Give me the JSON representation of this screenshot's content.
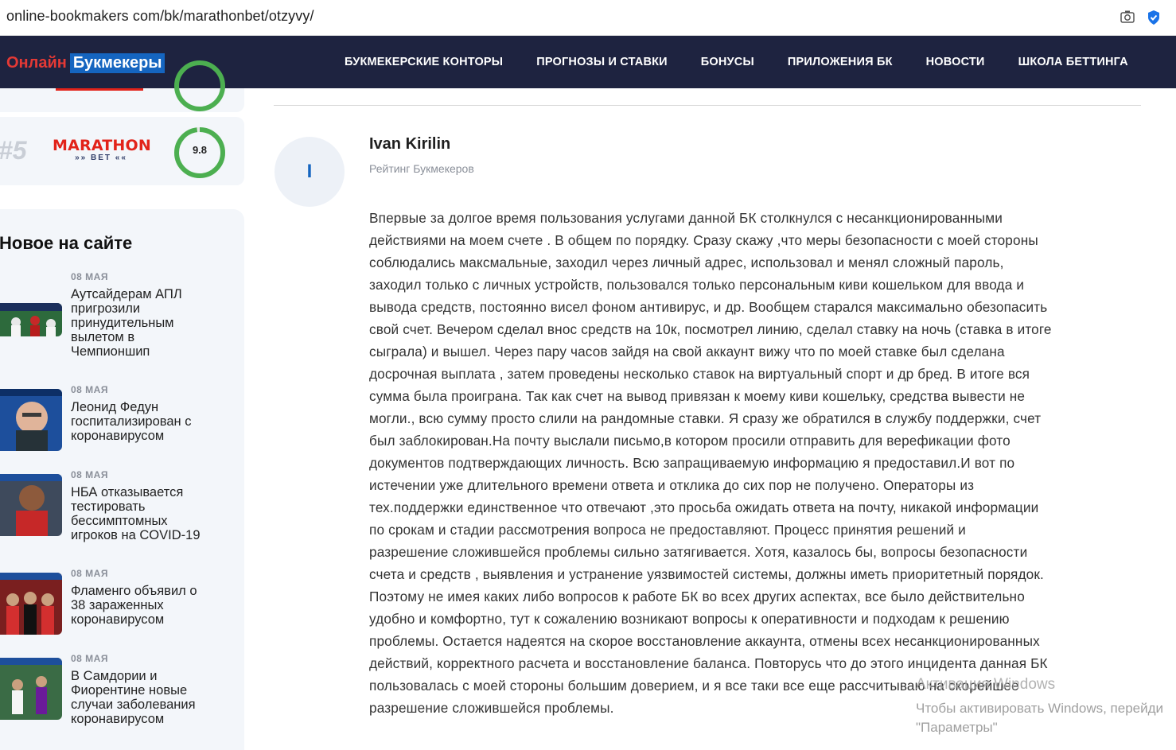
{
  "browser": {
    "url": "online-bookmakers com/bk/marathonbet/otzyvy/",
    "icons": [
      "camera-icon",
      "verified-shield-icon"
    ]
  },
  "header": {
    "logo_part1": "Онлайн",
    "logo_part2": "Букмекеры",
    "nav": [
      "БУКМЕКЕРСКИЕ КОНТОРЫ",
      "ПРОГНОЗЫ И СТАВКИ",
      "БОНУСЫ",
      "ПРИЛОЖЕНИЯ БК",
      "НОВОСТИ",
      "ШКОЛА БЕТТИНГА"
    ],
    "colors": {
      "bg": "#1e2340",
      "logo_red": "#e53935",
      "logo_blue": "#1565c0"
    }
  },
  "sidebar": {
    "rating": {
      "rank": "#5",
      "brand": "MARATHON",
      "brand_sub": "BET",
      "score": "9.8",
      "score_fraction": 0.98,
      "ring_color": "#4caf50"
    },
    "news_title": "Новое на сайте",
    "news": [
      {
        "date": "08 МАЯ",
        "lines": [
          "Аутсайдерам АПЛ",
          "пригрозили",
          "принудительным",
          "вылетом в",
          "Чемпионшип"
        ]
      },
      {
        "date": "08 МАЯ",
        "lines": [
          "Леонид Федун",
          "госпитализирован с",
          "коронавирусом"
        ]
      },
      {
        "date": "08 МАЯ",
        "lines": [
          "НБА отказывается",
          "тестировать",
          "бессимптомных",
          "игроков на COVID-19"
        ]
      },
      {
        "date": "08 МАЯ",
        "lines": [
          "Фламенго объявил о",
          "38 зараженных",
          "коронавирусом"
        ]
      },
      {
        "date": "08 МАЯ",
        "lines": [
          "В Самдории и",
          "Фиорентине новые",
          "случаи заболевания",
          "коронавирусом"
        ]
      }
    ]
  },
  "review": {
    "avatar_letter": "I",
    "author": "Ivan Kirilin",
    "author_sub": "Рейтинг Букмекеров",
    "lines": [
      "Впервые за долгое время пользования услугами данной БК столкнулся с несанкционированными",
      "действиями на моем счете . В общем по порядку. Сразу скажу ,что меры безопасности с моей стороны",
      "соблюдались максмальные, заходил через личный адрес, использовал и менял сложный пароль,",
      "заходил только с личных устройств, пользовался только персональным киви кошельком для ввода и",
      "вывода средств, постоянно висел фоном антивирус, и др. Вообщем старался максимально обезопасить",
      "свой счет. Вечером сделал внос средств на 10к, посмотрел линию, сделал ставку на ночь (ставка в итоге",
      "сыграла) и вышел. Через пару часов зайдя на свой аккаунт вижу что по моей ставке был сделана",
      "досрочная выплата , затем проведены несколько ставок на виртуальный спорт и др бред. В итоге вся",
      "сумма была проиграна. Так как счет на вывод привязан к моему киви кошельку, средства вывести не",
      "могли., всю сумму просто слили на рандомные ставки. Я сразу же обратился в службу поддержки, счет",
      "был заблокирован.На почту выслали письмо,в котором просили отправить для верефикации фото",
      "документов подтверждающих личность. Всю запращиваемую информацию я предоставил.И вот по",
      "истечении уже длительного времени ответа и отклика до сих пор не получено. Операторы из",
      "тех.поддержки единственное что отвечают ,это просьба ожидать ответа на почту, никакой информации",
      "по срокам и стадии рассмотрения вопроса не предоставляют. Процесс принятия решений и",
      "разрешение сложившейся проблемы сильно затягивается. Хотя, казалось бы, вопросы безопасности",
      "счета и средств , выявления и устранение уязвимостей системы, должны иметь приоритетный порядок.",
      "Поэтому не имея каких либо вопросов к работе БК во всех других аспектах, все было действительно",
      "удобно и комфортно, тут к сожалению возникают вопросы к оперативности и подходам к решению",
      "проблемы. Остается надеятся на скорое восстановление аккаунта, отмены всех несанкционированных",
      "действий, корректного расчета и восстановление баланса. Повторусь что до этого инцидента данная БК",
      "пользовалась с моей стороны большим доверием, и я все таки все еще рассчитываю на скорейшее",
      "разрешение сложившейся проблемы."
    ]
  },
  "watermark": {
    "line1": "Активация Windows",
    "line2": "Чтобы активировать Windows, перейди",
    "line3": "\"Параметры\""
  }
}
